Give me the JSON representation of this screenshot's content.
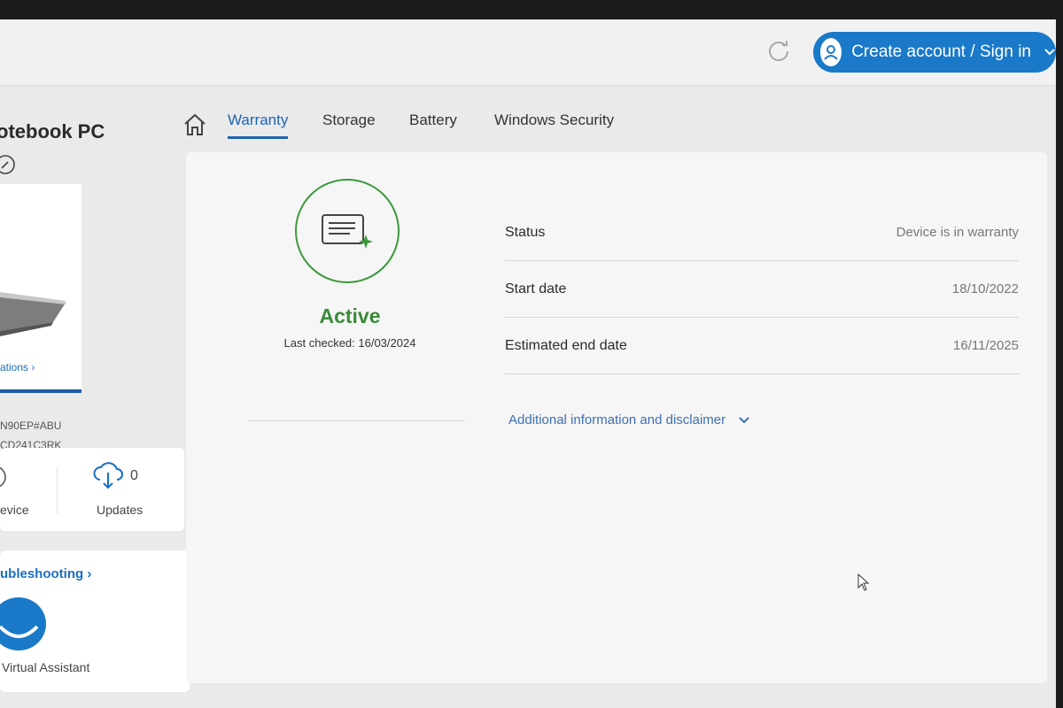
{
  "header": {
    "signin_label": "Create account / Sign in"
  },
  "device": {
    "title": "otebook PC",
    "specs_link": "ations ›",
    "product_code": "N90EP#ABU",
    "serial": "CD241C3RK"
  },
  "stats": {
    "device_label": "evice",
    "updates_label": "Updates",
    "updates_count": "0"
  },
  "support": {
    "troubleshooting_link": "ubleshooting ›",
    "assistant_label": "Virtual Assistant"
  },
  "tabs": [
    {
      "label": "Warranty",
      "active": true
    },
    {
      "label": "Storage",
      "active": false
    },
    {
      "label": "Battery",
      "active": false
    },
    {
      "label": "Windows Security",
      "active": false
    }
  ],
  "warranty": {
    "status_word": "Active",
    "last_checked": "Last checked: 16/03/2024",
    "rows": [
      {
        "key": "Status",
        "value": "Device is in warranty"
      },
      {
        "key": "Start date",
        "value": "18/10/2022"
      },
      {
        "key": "Estimated end date",
        "value": "16/11/2025"
      }
    ],
    "additional_info": "Additional information and disclaimer"
  },
  "colors": {
    "accent_blue": "#1a79c9",
    "active_green": "#3a8a3a",
    "tab_blue": "#1f63b4"
  }
}
